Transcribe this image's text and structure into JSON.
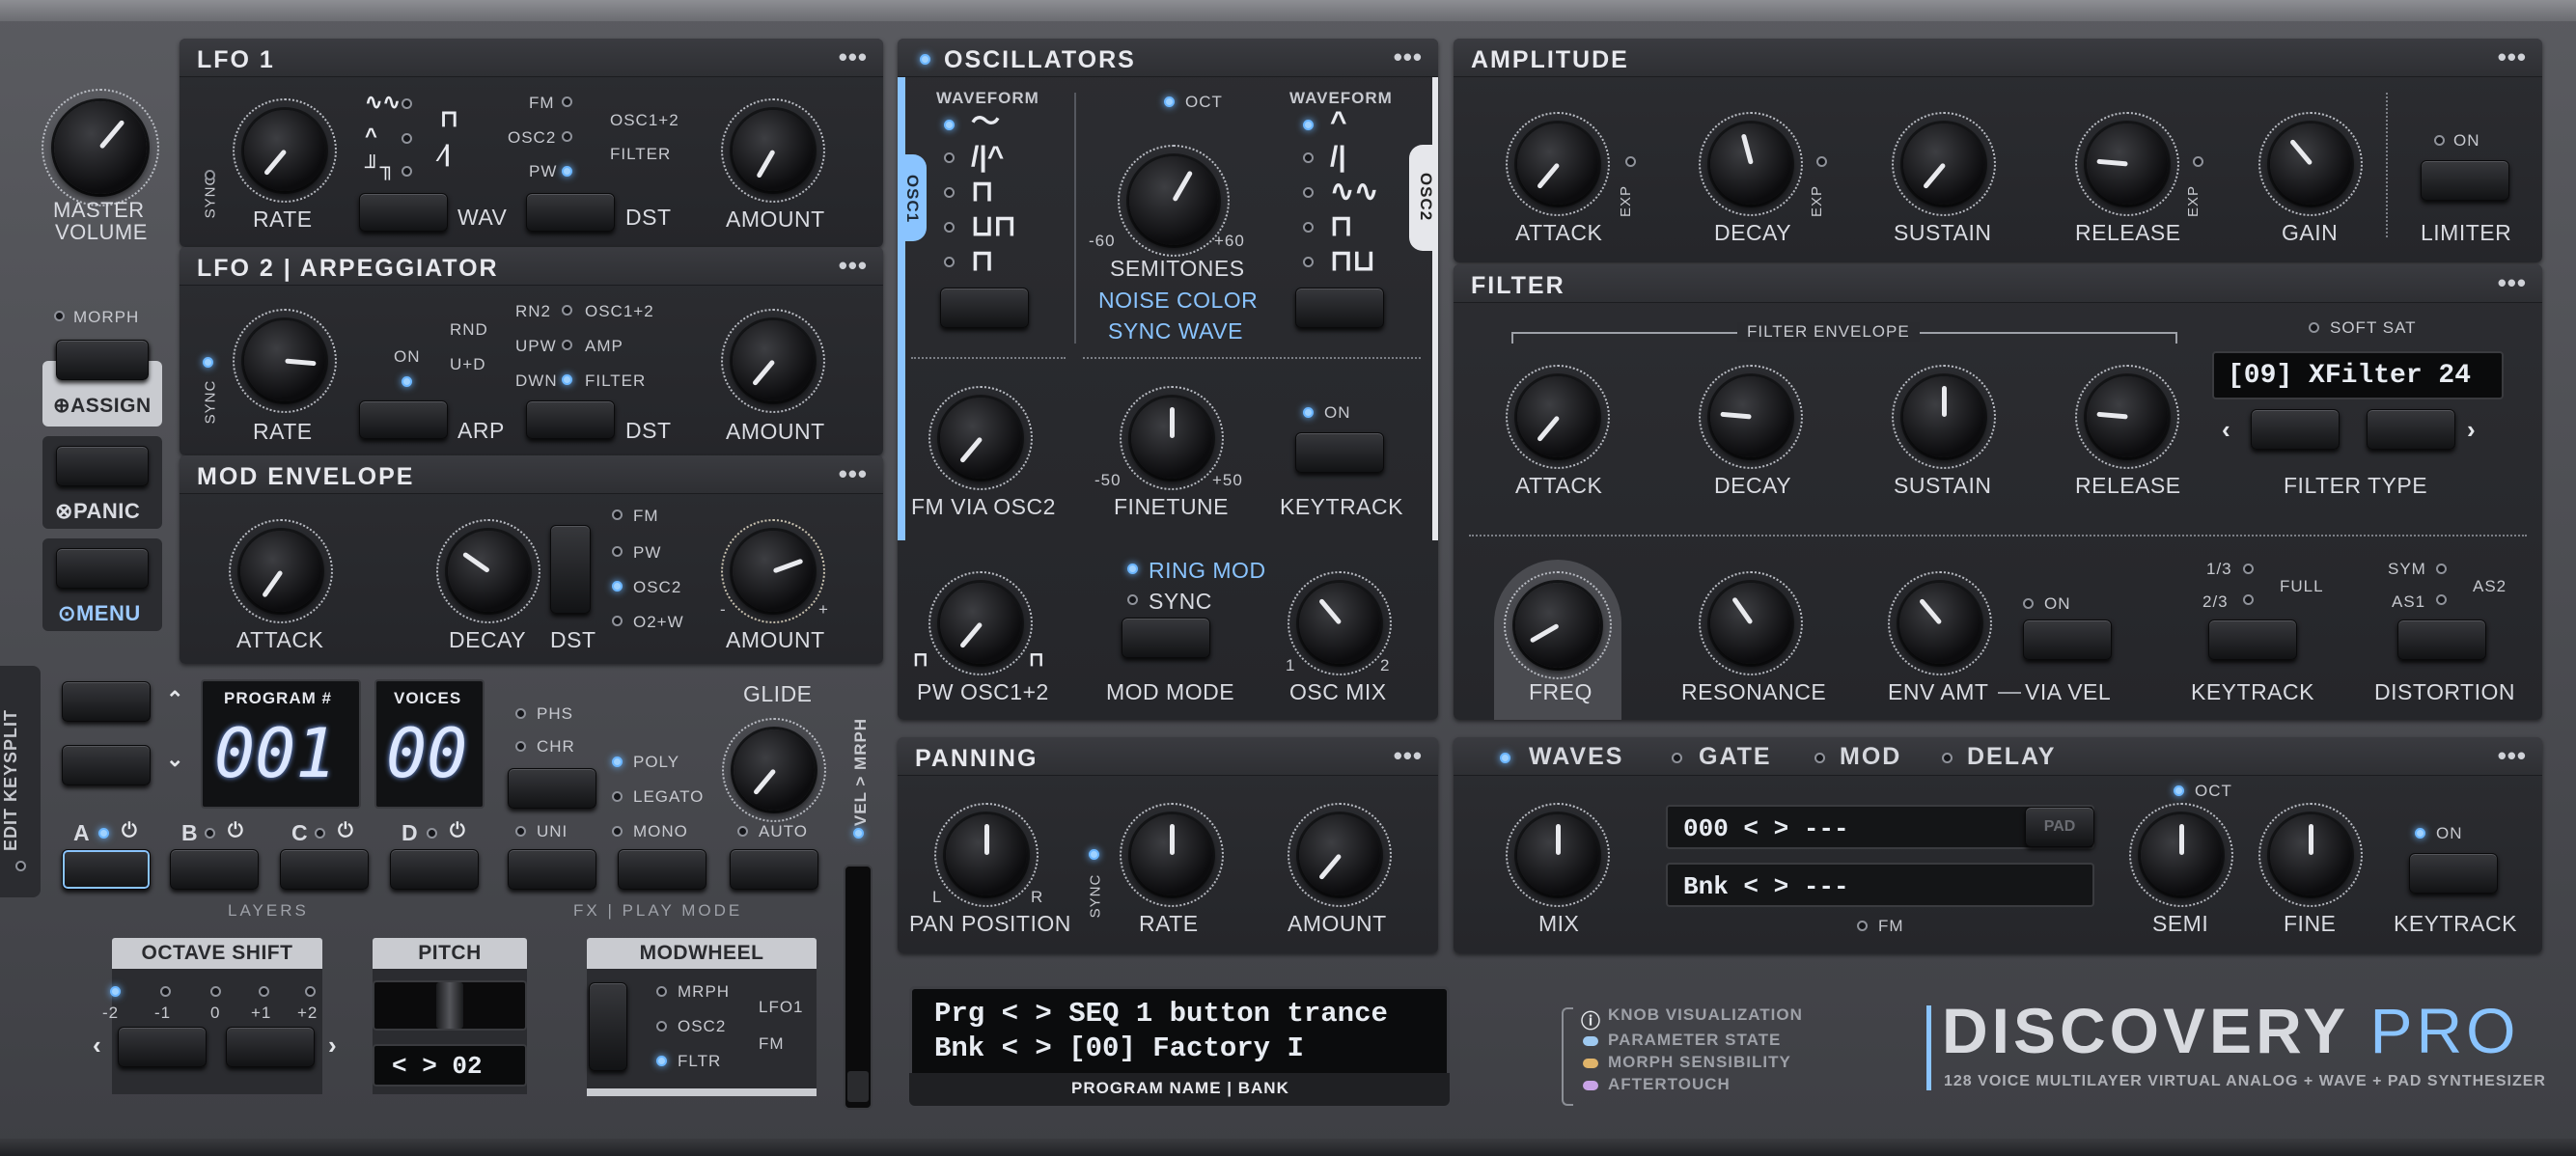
{
  "master": {
    "label1": "MASTER",
    "label2": "VOLUME"
  },
  "sidebar": {
    "morph": "MORPH",
    "assign": "ASSIGN",
    "panic": "PANIC",
    "menu": "MENU",
    "edit_keysplit": "EDIT KEYSPLIT"
  },
  "lfo1": {
    "title": "LFO 1",
    "sync": "SYNC",
    "rate": "RATE",
    "wav": "WAV",
    "dst": "DST",
    "amount": "AMOUNT",
    "dst_fm": "FM",
    "dst_osc2": "OSC2",
    "dst_pw": "PW",
    "dst_osc12": "OSC1+2",
    "dst_filter": "FILTER",
    "menu": "•••"
  },
  "lfo2": {
    "title": "LFO 2 | ARPEGGIATOR",
    "sync": "SYNC",
    "rate": "RATE",
    "on": "ON",
    "arp": "ARP",
    "dst": "DST",
    "amount": "AMOUNT",
    "rnd": "RND",
    "ud": "U+D",
    "rn2": "RN2",
    "upw": "UPW",
    "dwn": "DWN",
    "osc12": "OSC1+2",
    "amp": "AMP",
    "filter": "FILTER",
    "menu": "•••"
  },
  "modenv": {
    "title": "MOD ENVELOPE",
    "attack": "ATTACK",
    "decay": "DECAY",
    "dst": "DST",
    "amount": "AMOUNT",
    "fm": "FM",
    "pw": "PW",
    "osc2": "OSC2",
    "o2w": "O2+W",
    "minus": "-",
    "plus": "+",
    "menu": "•••"
  },
  "osc": {
    "title": "OSCILLATORS",
    "osc1_tab": "OSC1",
    "osc2_tab": "OSC2",
    "waveform1": "WAVEFORM",
    "waveform2": "WAVEFORM",
    "oct": "OCT",
    "semitones": "SEMITONES",
    "semi_min": "-60",
    "semi_max": "+60",
    "noise_color": "NOISE COLOR",
    "sync_wave": "SYNC WAVE",
    "fm_via": "FM VIA OSC2",
    "finetune": "FINETUNE",
    "fine_min": "-50",
    "fine_max": "+50",
    "keytrack": "KEYTRACK",
    "on": "ON",
    "ring_mod": "RING MOD",
    "sync": "SYNC",
    "pw_osc": "PW OSC1+2",
    "mod_mode": "MOD MODE",
    "osc_mix": "OSC MIX",
    "mix_1": "1",
    "mix_2": "2",
    "menu": "•••"
  },
  "amplitude": {
    "title": "AMPLITUDE",
    "attack": "ATTACK",
    "decay": "DECAY",
    "sustain": "SUSTAIN",
    "release": "RELEASE",
    "gain": "GAIN",
    "limiter": "LIMITER",
    "on": "ON",
    "exp": "EXP",
    "menu": "•••"
  },
  "filter": {
    "title": "FILTER",
    "filter_envelope": "FILTER ENVELOPE",
    "soft_sat": "SOFT SAT",
    "type_display": "[09] XFilter 24",
    "filter_type": "FILTER TYPE",
    "attack": "ATTACK",
    "decay": "DECAY",
    "sustain": "SUSTAIN",
    "release": "RELEASE",
    "freq": "FREQ",
    "resonance": "RESONANCE",
    "env_amt": "ENV AMT",
    "via_vel": "VIA VEL",
    "on": "ON",
    "k13": "1/3",
    "k23": "2/3",
    "full": "FULL",
    "keytrack": "KEYTRACK",
    "sym": "SYM",
    "as1": "AS1",
    "as2": "AS2",
    "distortion": "DISTORTION",
    "menu": "•••"
  },
  "panning": {
    "title": "PANNING",
    "pan_position": "PAN POSITION",
    "l": "L",
    "r": "R",
    "sync": "SYNC",
    "rate": "RATE",
    "amount": "AMOUNT",
    "menu": "•••"
  },
  "waves": {
    "tab_waves": "WAVES",
    "tab_gate": "GATE",
    "tab_mod": "MOD",
    "tab_delay": "DELAY",
    "wave_line": "000 < > ---",
    "pad": "PAD",
    "bank_line": "Bnk < > ---",
    "fm": "FM",
    "mix": "MIX",
    "oct": "OCT",
    "semi": "SEMI",
    "fine": "FINE",
    "on": "ON",
    "keytrack": "KEYTRACK",
    "menu": "•••"
  },
  "program": {
    "program_label": "PROGRAM #",
    "program_value": "001",
    "voices_label": "VOICES",
    "voices_value": "00",
    "layers": "LAYERS",
    "layer_a": "A",
    "layer_b": "B",
    "layer_c": "C",
    "layer_d": "D",
    "phs": "PHS",
    "chr": "CHR",
    "poly": "POLY",
    "legato": "LEGATO",
    "mono": "MONO",
    "uni": "UNI",
    "auto": "AUTO",
    "glide": "GLIDE",
    "fx_play": "FX | PLAY MODE",
    "vel_mrph": "VEL > MRPH"
  },
  "bottom": {
    "octave_shift": "OCTAVE SHIFT",
    "oct_vals": [
      "-2",
      "-1",
      "0",
      "+1",
      "+2"
    ],
    "pitch": "PITCH",
    "pitch_value": "< > 02",
    "modwheel": "MODWHEEL",
    "mrph": "MRPH",
    "osc2": "OSC2",
    "fltr": "FLTR",
    "lfo1": "LFO1",
    "fm": "FM"
  },
  "display": {
    "line1": "Prg < > SEQ 1 button trance",
    "line2": "Bnk < > [00] Factory I",
    "caption": "PROGRAM NAME | BANK"
  },
  "legend": {
    "title": "KNOB VISUALIZATION",
    "param_state": "PARAMETER STATE",
    "morph_sens": "MORPH SENSIBILITY",
    "aftertouch": "AFTERTOUCH"
  },
  "brand": {
    "name": "DISCOVERY",
    "pro": "PRO",
    "tagline": "128 VOICE MULTILAYER VIRTUAL ANALOG + WAVE + PAD SYNTHESIZER"
  },
  "colors": {
    "accent": "#6cb6ff",
    "param_state": "#9ec9f0",
    "morph_sens": "#e0b46a",
    "aftertouch": "#c8a3e6",
    "panel": "#2a2b2f"
  }
}
